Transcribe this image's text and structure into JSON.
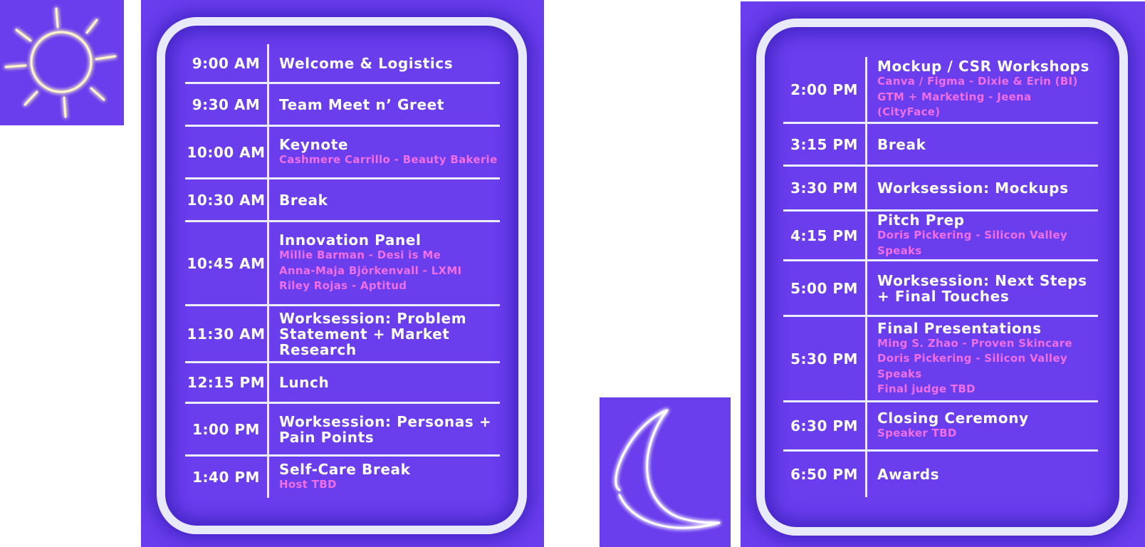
{
  "morning": {
    "items": [
      {
        "time": "9:00 AM",
        "title": "Welcome & Logistics",
        "subs": []
      },
      {
        "time": "9:30 AM",
        "title": "Team Meet n’ Greet",
        "subs": []
      },
      {
        "time": "10:00 AM",
        "title": "Keynote",
        "subs": [
          "Cashmere Carrillo - Beauty Bakerie"
        ]
      },
      {
        "time": "10:30 AM",
        "title": "Break",
        "subs": []
      },
      {
        "time": "10:45 AM",
        "title": "Innovation Panel",
        "subs": [
          "Millie Barman - Desi is Me",
          "Anna-Maja Björkenvall - LXMI",
          "Riley Rojas - Aptitud"
        ]
      },
      {
        "time": "11:30 AM",
        "title": "Worksession: Problem Statement + Market Research",
        "subs": []
      },
      {
        "time": "12:15 PM",
        "title": "Lunch",
        "subs": []
      },
      {
        "time": "1:00 PM",
        "title": "Worksession: Personas + Pain Points",
        "subs": []
      },
      {
        "time": "1:40 PM",
        "title": "Self-Care Break",
        "subs": [
          "Host TBD"
        ]
      }
    ]
  },
  "afternoon": {
    "items": [
      {
        "time": "2:00 PM",
        "title": "Mockup / CSR Workshops",
        "subs": [
          "Canva / Figma - Dixie & Erin (BI)",
          "GTM + Marketing - Jeena (CityFace)"
        ]
      },
      {
        "time": "3:15 PM",
        "title": "Break",
        "subs": []
      },
      {
        "time": "3:30 PM",
        "title": "Worksession: Mockups",
        "subs": []
      },
      {
        "time": "4:15 PM",
        "title": "Pitch Prep",
        "subs": [
          "Doris Pickering - Silicon Valley Speaks"
        ]
      },
      {
        "time": "5:00 PM",
        "title": "Worksession: Next Steps + Final Touches",
        "subs": []
      },
      {
        "time": "5:30 PM",
        "title": "Final Presentations",
        "subs": [
          "Ming S. Zhao - Proven Skincare",
          "Doris Pickering - Silicon Valley Speaks",
          "Final judge TBD"
        ]
      },
      {
        "time": "6:30 PM",
        "title": "Closing Ceremony",
        "subs": [
          "Speaker TBD"
        ]
      },
      {
        "time": "6:50 PM",
        "title": "Awards",
        "subs": []
      }
    ]
  },
  "colors": {
    "panel": "#6a3ded",
    "frame": "#e8eafc",
    "divider": "#eceefc",
    "text": "#ffffff",
    "speaker": "#f06fe6",
    "sun": "#fff6c8",
    "moon": "#ffffff"
  },
  "icons": {
    "morning": "sun-icon",
    "evening": "moon-icon"
  }
}
